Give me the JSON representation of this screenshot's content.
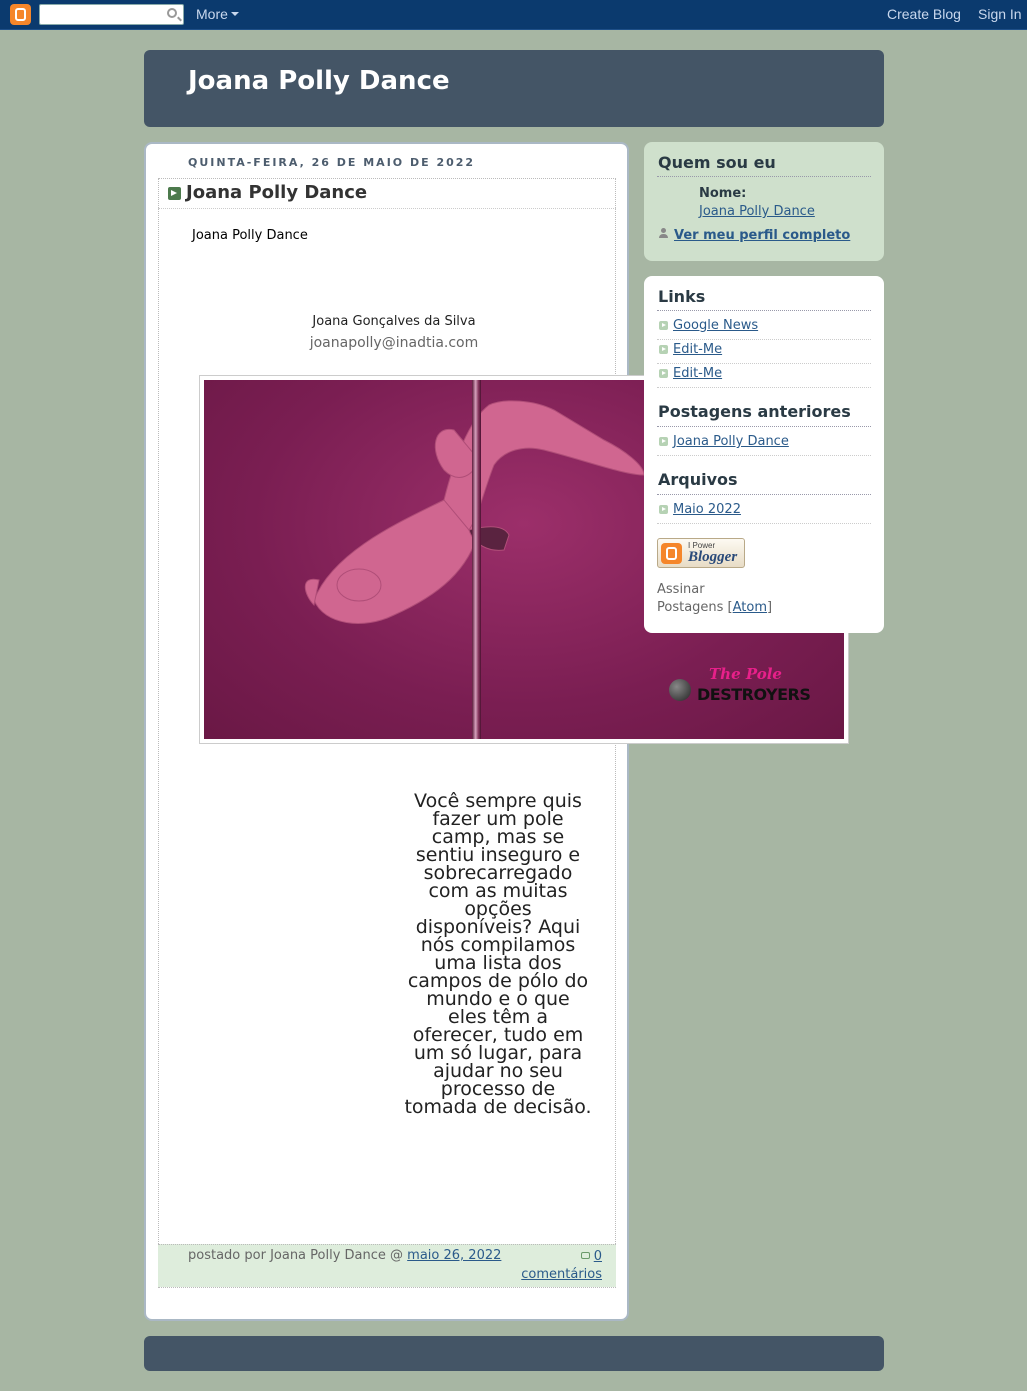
{
  "navbar": {
    "more_label": "More",
    "create_blog": "Create Blog",
    "sign_in": "Sign In"
  },
  "header": {
    "title": "Joana Polly Dance"
  },
  "post": {
    "date": "Quinta-feira, 26 de maio de 2022",
    "title": "Joana Polly Dance",
    "body_title": "Joana Polly Dance",
    "author_name": "Joana Gonçalves da Silva",
    "author_email": "joanapolly@inadtia.com",
    "image_brand_line1": "The Pole",
    "image_brand_line2": "DESTROYERS",
    "text": "Você sempre quis fazer um pole camp, mas se sentiu inseguro e sobrecarregado com as muitas opções disponíveis? Aqui nós compilamos uma lista dos campos de pólo do mundo e o que eles têm a oferecer, tudo em um só lugar, para ajudar no seu processo de tomada de decisão.",
    "footer": {
      "posted_by": "postado por Joana Polly Dance @",
      "date_link": "maio 26, 2022",
      "comments": "0 comentários"
    }
  },
  "sidebar": {
    "profile": {
      "heading": "Quem sou eu",
      "name_label": "Nome:",
      "name": "Joana Polly Dance",
      "full_profile": "Ver meu perfil completo"
    },
    "links_heading": "Links",
    "links": [
      "Google News",
      "Edit-Me",
      "Edit-Me"
    ],
    "previous_heading": "Postagens anteriores",
    "previous": [
      "Joana Polly Dance"
    ],
    "archives_heading": "Arquivos",
    "archives": [
      "Maio 2022"
    ],
    "powered_line1": "I Power",
    "powered_line2": "Blogger",
    "subscribe_text": "Assinar",
    "subscribe_posts": "Postagens [",
    "subscribe_atom": "Atom",
    "subscribe_close": "]"
  }
}
